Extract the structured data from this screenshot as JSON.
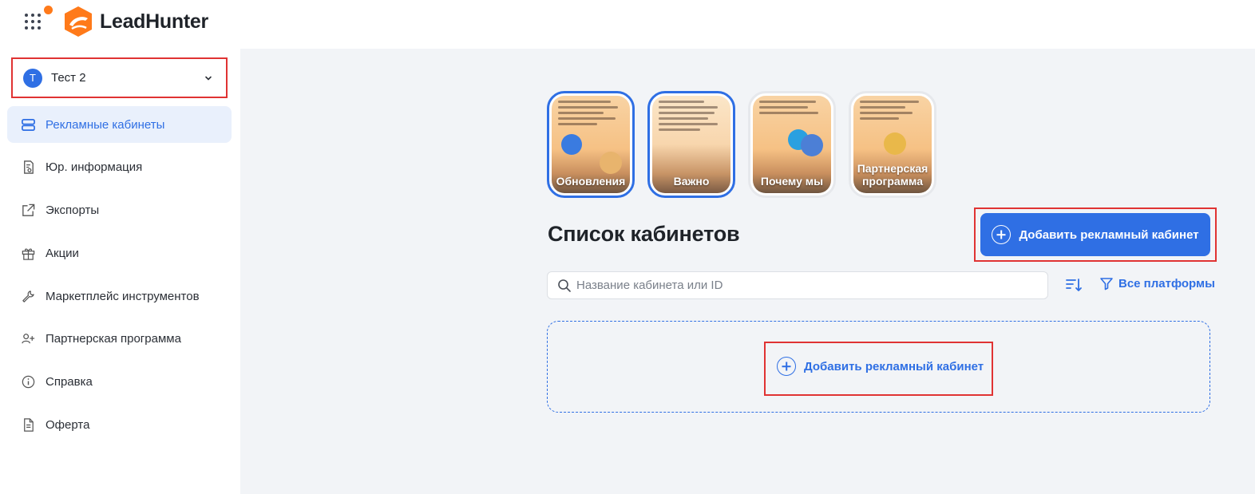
{
  "app": {
    "name": "LeadHunter",
    "brand_color": "#ff7a1a",
    "accent_color": "#2f6fe4"
  },
  "account": {
    "initial": "T",
    "name": "Тест 2"
  },
  "sidebar": {
    "items": [
      {
        "label": "Рекламные кабинеты",
        "icon": "cabinets-icon",
        "active": true
      },
      {
        "label": "Юр. информация",
        "icon": "legal-doc-icon",
        "active": false
      },
      {
        "label": "Экспорты",
        "icon": "export-icon",
        "active": false
      },
      {
        "label": "Акции",
        "icon": "gift-icon",
        "active": false
      },
      {
        "label": "Маркетплейс инструментов",
        "icon": "wrench-icon",
        "active": false
      },
      {
        "label": "Партнерская программа",
        "icon": "user-plus-icon",
        "active": false
      },
      {
        "label": "Справка",
        "icon": "info-icon",
        "active": false
      },
      {
        "label": "Оферта",
        "icon": "document-icon",
        "active": false
      }
    ]
  },
  "stories": [
    {
      "label": "Обновления",
      "seen": false
    },
    {
      "label": "Важно",
      "seen": false
    },
    {
      "label": "Почему мы",
      "seen": true
    },
    {
      "label": "Партнерская программа",
      "seen": true
    }
  ],
  "main": {
    "title": "Список кабинетов",
    "add_button_label": "Добавить рекламный кабинет",
    "search_placeholder": "Название кабинета или ID",
    "filter_label": "Все платформы",
    "empty_add_label": "Добавить рекламный кабинет"
  }
}
